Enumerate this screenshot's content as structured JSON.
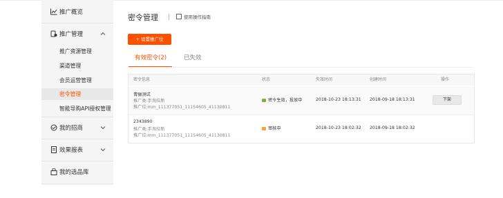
{
  "sidebar": {
    "overview": "推广概览",
    "promotion_mgmt": "推广管理",
    "sub_items": [
      "推广资源管理",
      "渠道管理",
      "会员运营管理",
      "密令管理",
      "智能导购API授权管理"
    ],
    "active_sub_index": 3,
    "recruit": "我的招商",
    "reports": "效果报表",
    "selection": "我的选品库"
  },
  "header": {
    "title": "密令管理",
    "guide": "使用操作指南"
  },
  "toolbar": {
    "set_button": "+ 设置推广位"
  },
  "tabs": [
    {
      "label": "有效密令(2)",
      "active": true
    },
    {
      "label": "已失效",
      "active": false
    }
  ],
  "table": {
    "columns": [
      "密令信息",
      "状态",
      "失效时间",
      "创建时间",
      "操作"
    ],
    "rows": [
      {
        "name": "青骊测试",
        "line2": "推广类:手淘拉新",
        "line3": "推广位:mm_111377051_11154605_41130811",
        "status": "密令生效，投放中",
        "status_color": "#7cb342",
        "expire": "2018-10-23 18:13:31",
        "created": "2018-09-18 18:13:31",
        "action": "下架"
      },
      {
        "name": "2343890",
        "line2": "推广类:手淘拉新",
        "line3": "推广位:mm_111377051_11154605_41130811",
        "status": "审核中",
        "status_color": "#ff9f43",
        "expire": "2018-10-23 18:02:32",
        "created": "2018-09-18 18:02:32",
        "action": ""
      }
    ]
  },
  "colors": {
    "accent": "#ff5000"
  }
}
